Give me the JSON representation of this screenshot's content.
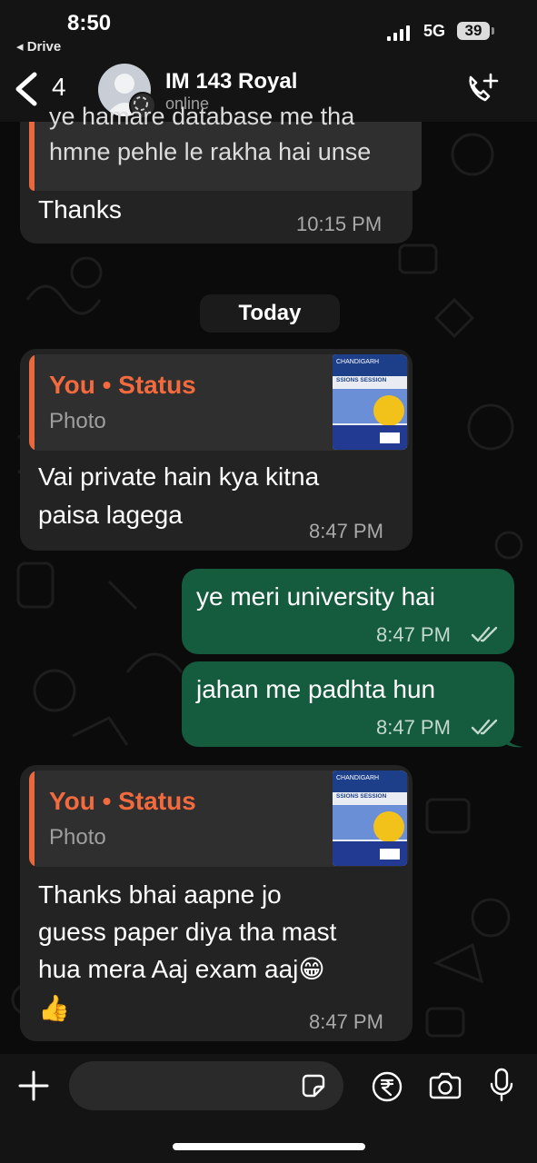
{
  "status_bar": {
    "time": "8:50",
    "back_app": "◂ Drive",
    "network": "5G",
    "battery": "39"
  },
  "header": {
    "unread_count": "4",
    "contact_name": "IM 143 Royal",
    "contact_status": "online"
  },
  "messages": {
    "m0": {
      "quote_fragment": "ye hamare database me tha",
      "quote_line": "hmne pehle le rakha hai unse",
      "text": "Thanks",
      "time": "10:15 PM"
    },
    "date_separator": "Today",
    "m1": {
      "quote_title": "You • Status",
      "quote_sub": "Photo",
      "text_line1": "Vai private hain kya kitna",
      "text_line2": "paisa lagega",
      "time": "8:47 PM"
    },
    "m2": {
      "text": "ye meri university hai",
      "time": "8:47 PM"
    },
    "m3": {
      "text": "jahan me padhta hun",
      "time": "8:47 PM"
    },
    "m4": {
      "quote_title": "You • Status",
      "quote_sub": "Photo",
      "text_line1": "Thanks bhai aapne jo",
      "text_line2": "guess paper diya tha mast",
      "text_line3": "hua mera Aaj exam aaj😁",
      "text_line4": "👍",
      "time": "8:47 PM"
    }
  },
  "status_thumbnail": {
    "line_top": "CHANDIGARH",
    "line_mid": "SSIONS SESSION"
  },
  "colors": {
    "incoming": "#232323",
    "outgoing": "#155c3f",
    "quote_accent": "#f26a3d",
    "background": "#0b0b0b"
  },
  "icons": [
    "chevron-left-icon",
    "avatar-person-icon",
    "phone-add-icon",
    "plus-icon",
    "sticker-icon",
    "rupee-icon",
    "camera-icon",
    "microphone-icon",
    "double-check-icon"
  ]
}
